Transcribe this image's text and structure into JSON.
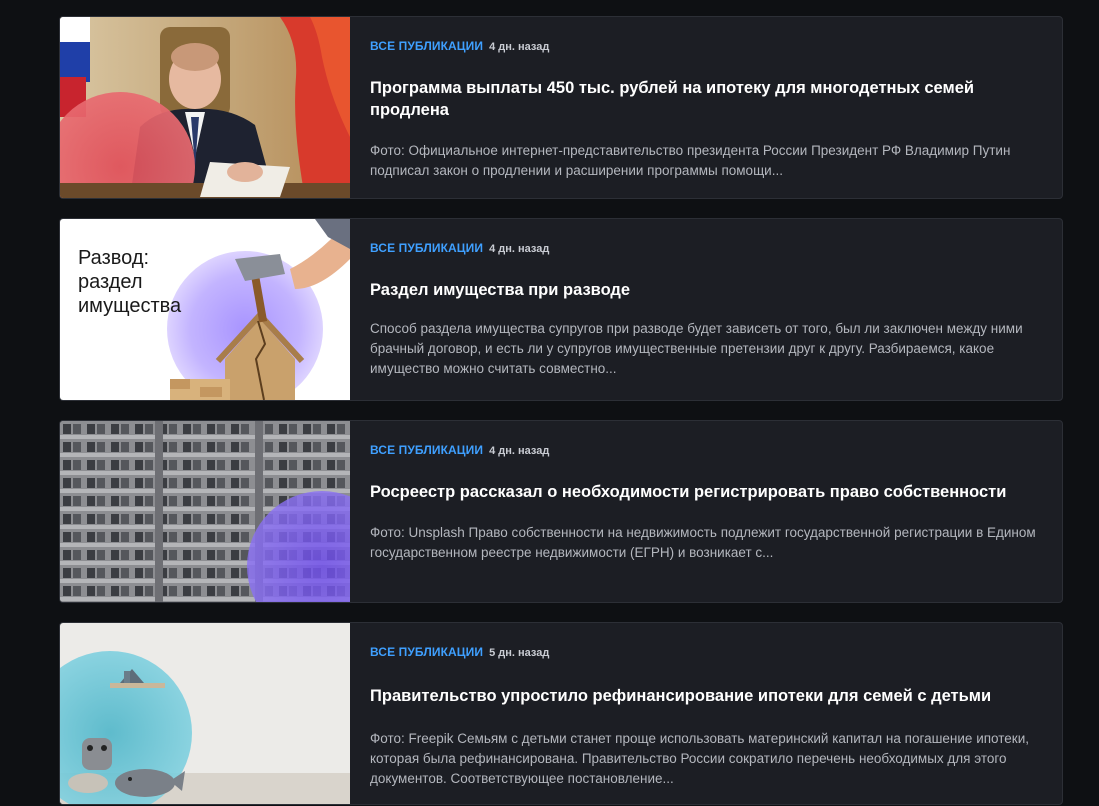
{
  "articles": [
    {
      "category": "ВСЕ ПУБЛИКАЦИИ",
      "time": "4 дн. назад",
      "title": "Программа выплаты 450 тыс. рублей на ипотеку для многодетных семей продлена",
      "excerpt": "Фото: Официальное интернет-представительство президента России Президент РФ Владимир Путин подписал закон о продлении и расширении программы помощи..."
    },
    {
      "category": "ВСЕ ПУБЛИКАЦИИ",
      "time": "4 дн. назад",
      "title": "Раздел имущества при разводе",
      "excerpt": "Способ раздела имущества супругов при разводе будет зависеть от того, был ли заключен между ними брачный договор, и есть ли у супругов имущественные претензии друг к другу. Разбираемся, какое имущество можно считать совместно...",
      "image_text": "Развод:\nраздел\nимущества"
    },
    {
      "category": "ВСЕ ПУБЛИКАЦИИ",
      "time": "4 дн. назад",
      "title": "Росреестр рассказал о необходимости регистрировать право собственности",
      "excerpt": "Фото: Unsplash Право собственности на недвижимость подлежит государственной регистрации в Едином государственном реестре недвижимости (ЕГРН) и возникает с..."
    },
    {
      "category": "ВСЕ ПУБЛИКАЦИИ",
      "time": "5 дн. назад",
      "title": "Правительство упростило рефинансирование ипотеки для семей с детьми",
      "excerpt": "Фото: Freepik Семьям с детьми станет проще использовать материнский капитал на погашение ипотеки, которая была рефинансирована. Правительство России сократило перечень необходимых для этого документов. Соответствующее постановление..."
    }
  ],
  "colors": {
    "background": "#0e1013",
    "card": "#1c1e24",
    "category": "#3fa0ff",
    "title": "#ffffff",
    "excerpt": "#b4b7be"
  }
}
